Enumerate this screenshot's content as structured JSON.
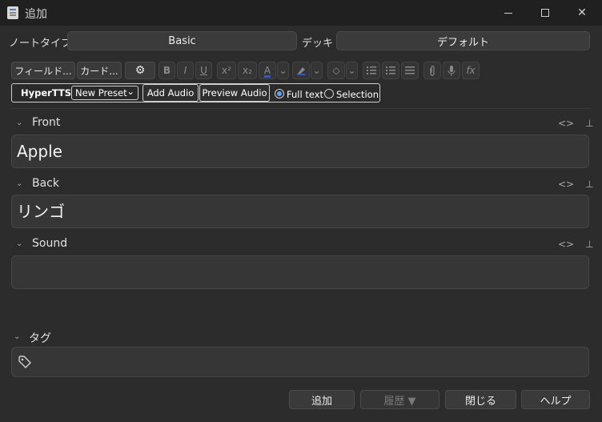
{
  "window": {
    "title": "追加",
    "min_glyph": "",
    "close_glyph": "✕"
  },
  "notetype": {
    "label": "ノートタイプ",
    "value": "Basic"
  },
  "deck": {
    "label": "デッキ",
    "value": "デフォルト"
  },
  "toolbar": {
    "fields_button": "フィールド...",
    "cards_button": "カード...",
    "gear_glyph": "⚙",
    "bold": "B",
    "italic": "I",
    "underline": "U",
    "superscript": "x²",
    "subscript": "x₂",
    "text_color": "A",
    "dropdown_glyph": "⌄",
    "eraser_glyph": "◇",
    "fx": "fx"
  },
  "hypertts": {
    "name": "HyperTTS",
    "preset": "New Preset",
    "preset_arrow": "⌄",
    "add_audio": "Add Audio",
    "preview_audio": "Preview Audio",
    "mode_full_text": "Full text",
    "mode_selection": "Selection",
    "selected_mode": "Full text"
  },
  "fields": [
    {
      "name": "Front",
      "value": "Apple"
    },
    {
      "name": "Back",
      "value": "リンゴ"
    },
    {
      "name": "Sound",
      "value": ""
    }
  ],
  "field_tools": {
    "html_toggle": "<>",
    "pin": "⊥",
    "collapse": "⌄"
  },
  "tags": {
    "label": "タグ",
    "tag_icon": "🏷"
  },
  "buttons": {
    "add": "追加",
    "history": "履歴 ▼",
    "close": "閉じる",
    "help": "ヘルプ"
  }
}
